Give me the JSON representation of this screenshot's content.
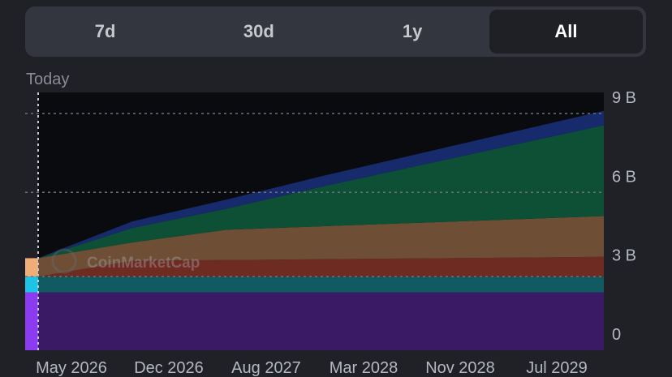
{
  "tabs": [
    {
      "label": "7d",
      "active": false
    },
    {
      "label": "30d",
      "active": false
    },
    {
      "label": "1y",
      "active": false
    },
    {
      "label": "All",
      "active": true
    }
  ],
  "today_label": "Today",
  "watermark": "CoinMarketCap",
  "colors": {
    "background": "#202127",
    "plot_background": "#0a0b0e",
    "tab_bar": "#34363f",
    "tab_active": "#1f2026"
  },
  "chart_data": {
    "type": "area",
    "stacked": true,
    "x_ticks": [
      "May 2026",
      "Dec 2026",
      "Aug 2027",
      "Mar 2028",
      "Nov 2028",
      "Jul 2029"
    ],
    "y_ticks": [
      "0",
      "3 B",
      "6 B",
      "9 B"
    ],
    "ylim": [
      0,
      9.8
    ],
    "grid": false,
    "today_marker": true,
    "series": [
      {
        "color": "#3a1a64",
        "values": [
          2.2,
          2.2,
          2.2,
          2.2,
          2.2,
          2.2,
          2.2
        ]
      },
      {
        "color": "#115a62",
        "values": [
          0.6,
          0.6,
          0.6,
          0.6,
          0.6,
          0.6,
          0.6
        ]
      },
      {
        "color": "#6e2b22",
        "values": [
          0,
          0.6,
          0.63,
          0.66,
          0.69,
          0.72,
          0.75
        ]
      },
      {
        "color": "#6e4f35",
        "values": [
          0.7,
          0.7,
          1.15,
          1.25,
          1.35,
          1.45,
          1.55
        ]
      },
      {
        "color": "#0d5035",
        "values": [
          0,
          0.55,
          0.8,
          1.5,
          2.15,
          2.8,
          3.45
        ]
      },
      {
        "color": "#172b6c",
        "values": [
          0,
          0.25,
          0.35,
          0.4,
          0.45,
          0.5,
          0.55
        ]
      }
    ]
  }
}
